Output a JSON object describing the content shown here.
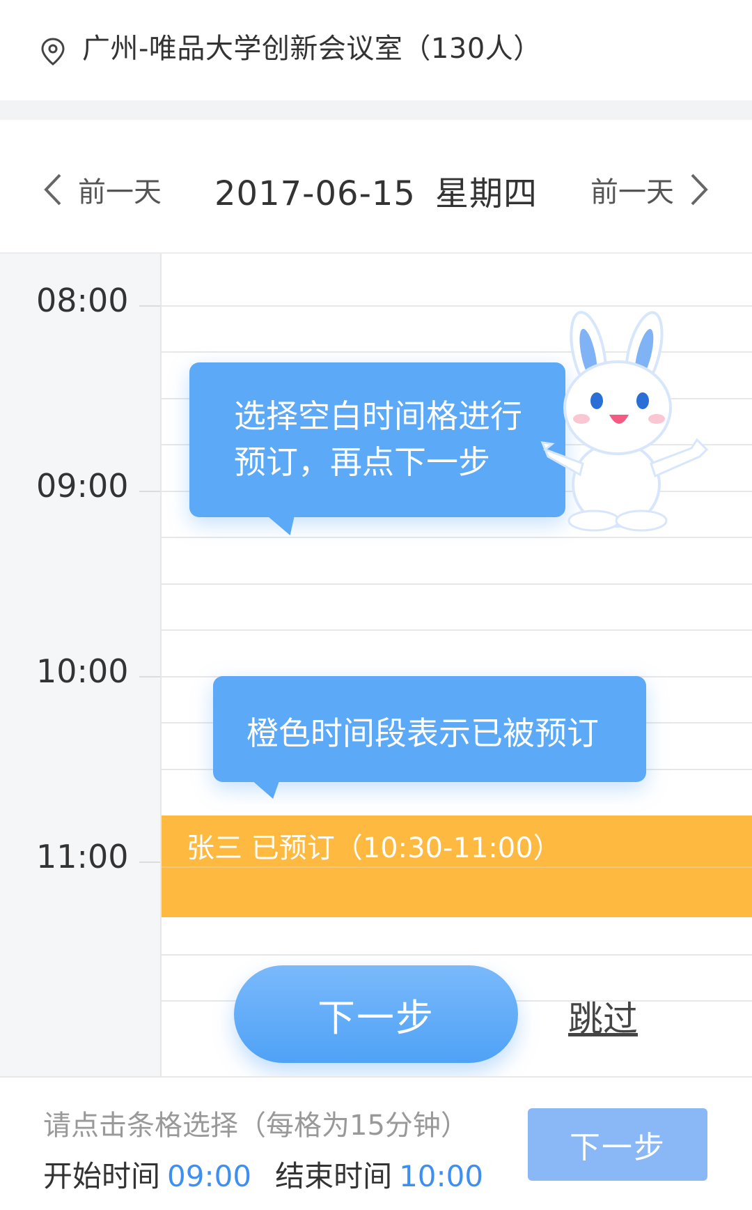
{
  "location": {
    "text": "广州-唯品大学创新会议室（130人）"
  },
  "date_nav": {
    "prev_label": "前一天",
    "next_label": "前一天",
    "date": "2017-06-15",
    "weekday": "星期四"
  },
  "timeline": {
    "hours": [
      "08:00",
      "09:00",
      "10:00",
      "11:00"
    ],
    "booking": {
      "text": "张三 已预订（10:30-11:00）"
    }
  },
  "guide": {
    "tip1_line1": "选择空白时间格进行",
    "tip1_line2": "预订，再点下一步",
    "tip2": "橙色时间段表示已被预订",
    "next_label": "下一步",
    "skip_label": "跳过"
  },
  "bottom": {
    "hint": "请点击条格选择（每格为15分钟）",
    "start_label": "开始时间",
    "start_value": "09:00",
    "end_label": "结束时间",
    "end_value": "10:00",
    "next_label": "下一步"
  },
  "colors": {
    "accent": "#5ba9f7",
    "booked": "#fdb940",
    "time_value": "#3d8ff2",
    "bottom_button": "#8ab8f7"
  }
}
